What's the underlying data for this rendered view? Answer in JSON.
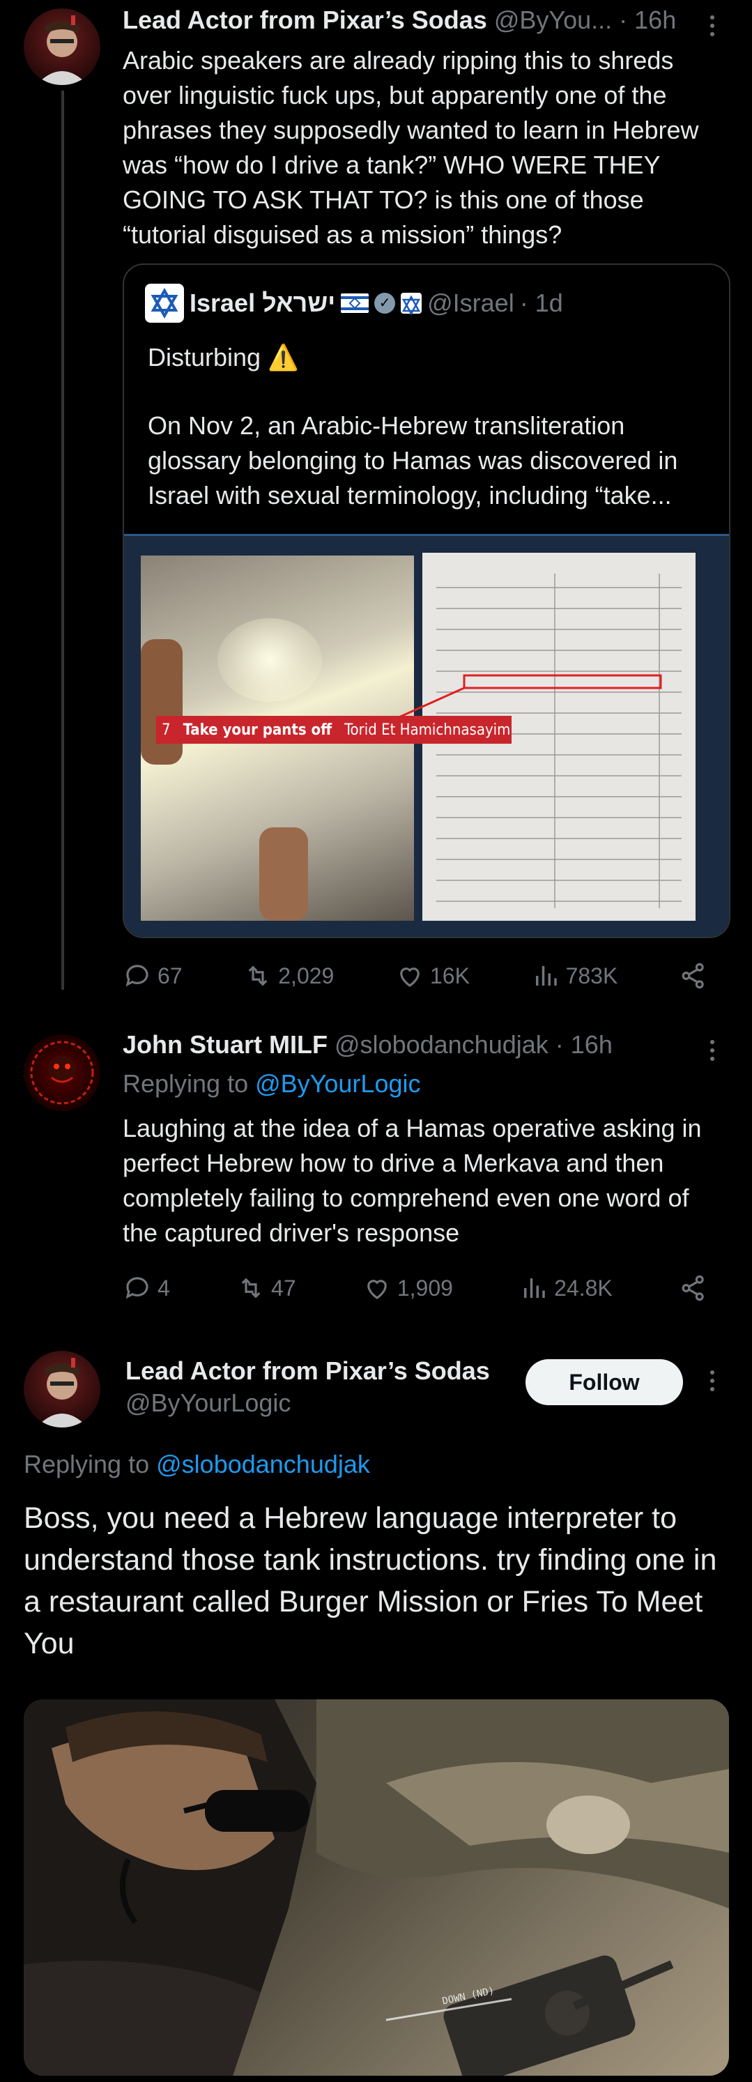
{
  "tweet1": {
    "author_name": "Lead Actor from Pixar’s Sodas",
    "handle": "@ByYou...",
    "time": "· 16h",
    "text": "Arabic speakers are already ripping this to shreds over linguistic fuck ups, but apparently one of the phrases they supposedly wanted to learn in Hebrew was “how do I drive a tank?” WHO WERE THEY GOING TO ASK THAT TO? is this one of those “tutorial disguised as a mission” things?",
    "quote": {
      "author_name": "Israel ישראל",
      "flags": "🇮🇱",
      "handle": "@Israel",
      "time": "· 1d",
      "line1": "Disturbing ⚠️",
      "line2": "On Nov 2, an Arabic-Hebrew transliteration glossary belonging to Hamas was discovered in Israel with sexual terminology, including “take...",
      "image_caption_number": "7",
      "image_caption_english": "Take your pants off",
      "image_caption_translit": "Torid Et Hamichnasayim"
    },
    "replies": "67",
    "reposts": "2,029",
    "likes": "16K",
    "views": "783K"
  },
  "tweet2": {
    "author_name": "John Stuart MILF",
    "handle": "@slobodanchudjak",
    "time": "· 16h",
    "replying_prefix": "Replying to",
    "replying_to": "@ByYourLogic",
    "text": "Laughing at the idea of a Hamas operative asking in perfect Hebrew how to drive a Merkava and then completely failing to comprehend even one word of the captured driver's response",
    "replies": "4",
    "reposts": "47",
    "likes": "1,909",
    "views": "24.8K"
  },
  "tweet3": {
    "author_name": "Lead Actor from Pixar’s Sodas",
    "handle": "@ByYourLogic",
    "follow_label": "Follow",
    "replying_prefix": "Replying to",
    "replying_to": "@slobodanchudjak",
    "text": "Boss, you need a Hebrew language interpreter to understand those tank instructions. try finding one in a restaurant called Burger Mission or Fries To Meet You",
    "image_hud_text": "DOWN (ND)"
  },
  "colors": {
    "accent": "#1d9bf0",
    "muted": "#71767b",
    "verified": "#829aab"
  }
}
